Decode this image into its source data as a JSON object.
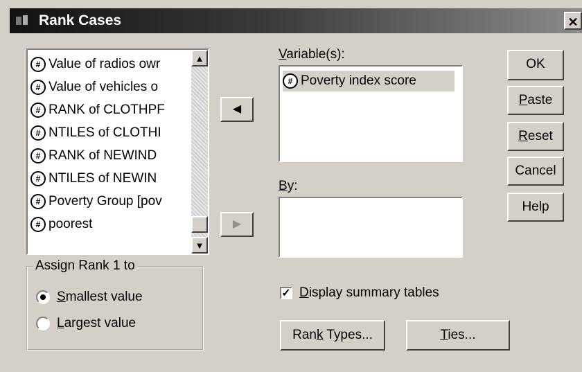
{
  "window": {
    "title": "Rank Cases",
    "close_label": "✕"
  },
  "source_list": {
    "items": [
      "Value of radios owr",
      "Value of vehicles o",
      "RANK of CLOTHPF",
      "NTILES of CLOTHI",
      "RANK of NEWIND",
      "NTILES of NEWIN",
      "Poverty Group [pov",
      "poorest"
    ]
  },
  "variables": {
    "label_pre": "",
    "label_u": "V",
    "label_post": "ariable(s):",
    "items": [
      "Poverty index score"
    ]
  },
  "by": {
    "label_u": "B",
    "label_post": "y:"
  },
  "buttons": {
    "ok": "OK",
    "paste_u": "P",
    "paste_post": "aste",
    "reset_u": "R",
    "reset_post": "eset",
    "cancel": "Cancel",
    "help": "Help",
    "rank_types_pre": "Ran",
    "rank_types_u": "k",
    "rank_types_post": " Types...",
    "ties_u": "T",
    "ties_post": "ies..."
  },
  "assign_rank": {
    "legend": "Assign Rank 1 to",
    "smallest_u": "S",
    "smallest_post": "mallest value",
    "largest_u": "L",
    "largest_post": "argest value",
    "selected": "smallest"
  },
  "summary": {
    "label_u": "D",
    "label_post": "isplay summary tables",
    "checked": true
  },
  "icons": {
    "variable": "numeric-variable-icon",
    "move_left": "arrow-left-icon",
    "move_right": "arrow-right-icon"
  }
}
